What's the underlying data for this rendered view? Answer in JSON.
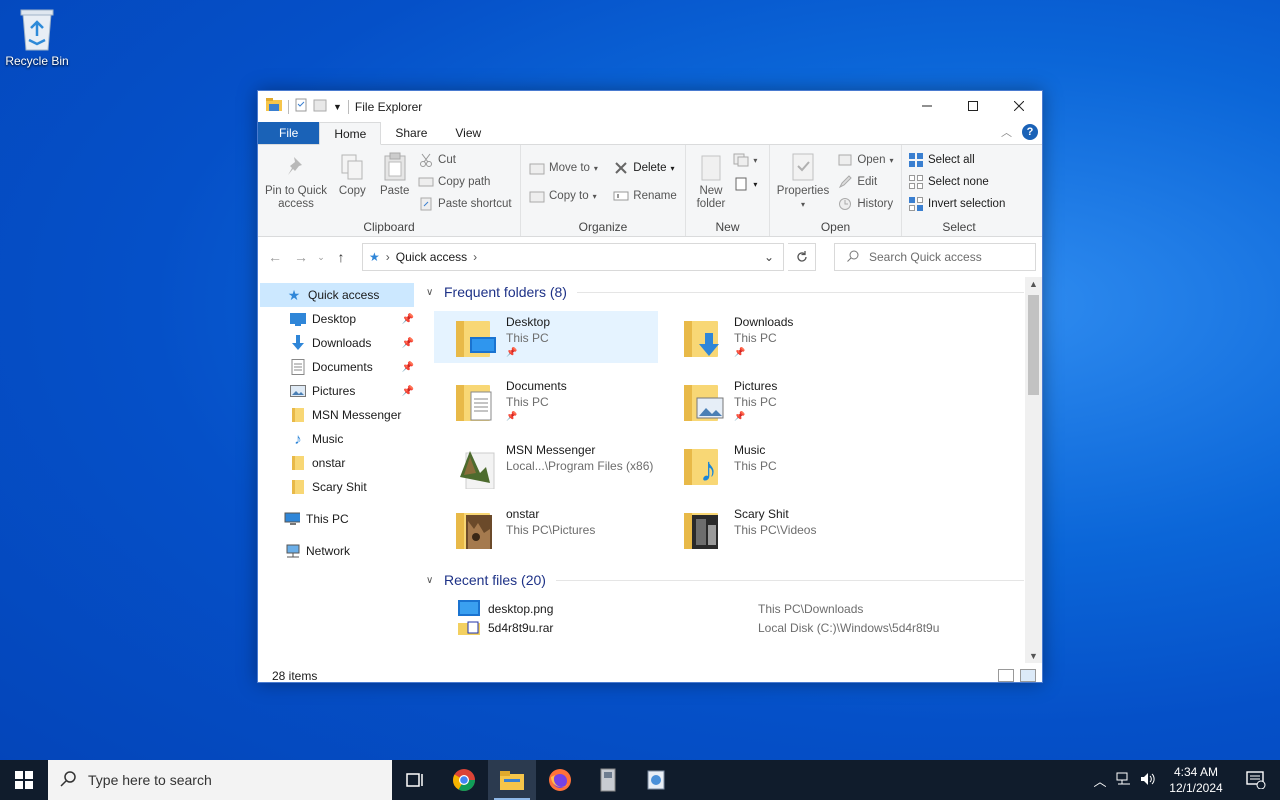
{
  "desktop": {
    "recycle_bin_label": "Recycle Bin"
  },
  "window": {
    "title": "File Explorer",
    "tabs": [
      {
        "label": "File"
      },
      {
        "label": "Home"
      },
      {
        "label": "Share"
      },
      {
        "label": "View"
      }
    ]
  },
  "ribbon": {
    "clipboard": {
      "name": "Clipboard",
      "pin_label_1": "Pin to Quick",
      "pin_label_2": "access",
      "copy": "Copy",
      "paste": "Paste",
      "cut": "Cut",
      "copy_path": "Copy path",
      "paste_shortcut": "Paste shortcut"
    },
    "organize": {
      "name": "Organize",
      "move_to": "Move to",
      "copy_to": "Copy to",
      "delete": "Delete",
      "rename": "Rename"
    },
    "new": {
      "name": "New",
      "new_folder_1": "New",
      "new_folder_2": "folder"
    },
    "open": {
      "name": "Open",
      "properties": "Properties",
      "open": "Open",
      "edit": "Edit",
      "history": "History"
    },
    "select": {
      "name": "Select",
      "select_all": "Select all",
      "select_none": "Select none",
      "invert": "Invert selection"
    }
  },
  "address": {
    "location": "Quick access",
    "search_placeholder": "Search Quick access"
  },
  "nav": {
    "quick_access": "Quick access",
    "items": [
      {
        "label": "Desktop"
      },
      {
        "label": "Downloads"
      },
      {
        "label": "Documents"
      },
      {
        "label": "Pictures"
      },
      {
        "label": "MSN Messenger"
      },
      {
        "label": "Music"
      },
      {
        "label": "onstar"
      },
      {
        "label": "Scary Shit"
      }
    ],
    "this_pc": "This PC",
    "network": "Network"
  },
  "frequent": {
    "header": "Frequent folders (8)",
    "items": [
      {
        "name": "Desktop",
        "path": "This PC"
      },
      {
        "name": "Downloads",
        "path": "This PC"
      },
      {
        "name": "Documents",
        "path": "This PC"
      },
      {
        "name": "Pictures",
        "path": "This PC"
      },
      {
        "name": "MSN Messenger",
        "path": "Local...\\Program Files (x86)"
      },
      {
        "name": "Music",
        "path": "This PC"
      },
      {
        "name": "onstar",
        "path": "This PC\\Pictures"
      },
      {
        "name": "Scary Shit",
        "path": "This PC\\Videos"
      }
    ]
  },
  "recent": {
    "header": "Recent files (20)",
    "items": [
      {
        "name": "desktop.png",
        "path": "This PC\\Downloads"
      },
      {
        "name": "5d4r8t9u.rar",
        "path": "Local Disk (C:)\\Windows\\5d4r8t9u"
      }
    ]
  },
  "status": {
    "count": "28 items"
  },
  "taskbar": {
    "search_placeholder": "Type here to search",
    "time": "4:34 AM",
    "date": "12/1/2024"
  }
}
